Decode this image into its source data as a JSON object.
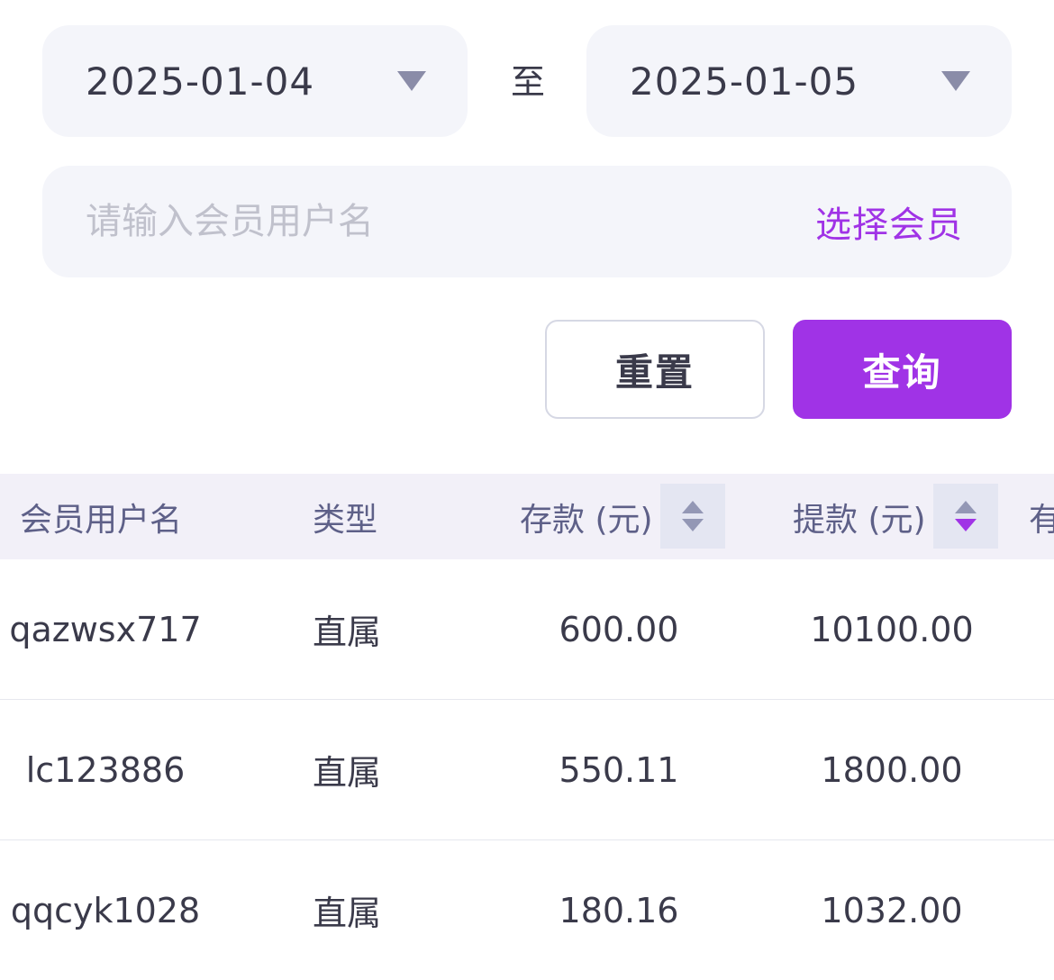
{
  "date_range": {
    "start": "2025-01-04",
    "separator": "至",
    "end": "2025-01-05"
  },
  "member_search": {
    "placeholder": "请输入会员用户名",
    "value": "",
    "select_label": "选择会员"
  },
  "actions": {
    "reset_label": "重置",
    "query_label": "查询"
  },
  "colors": {
    "accent": "#a033e6",
    "field_bg": "#f4f5fa",
    "header_bg": "#f2f0f8",
    "header_text": "#5e6088"
  },
  "table": {
    "columns": [
      "会员用户名",
      "类型",
      "存款 (元)",
      "提款 (元)",
      "有"
    ],
    "rows": [
      {
        "user": "qazwsx717",
        "type": "直属",
        "deposit": "600.00",
        "withdraw": "10100.00"
      },
      {
        "user": "lc123886",
        "type": "直属",
        "deposit": "550.11",
        "withdraw": "1800.00"
      },
      {
        "user": "qqcyk1028",
        "type": "直属",
        "deposit": "180.16",
        "withdraw": "1032.00"
      }
    ]
  }
}
